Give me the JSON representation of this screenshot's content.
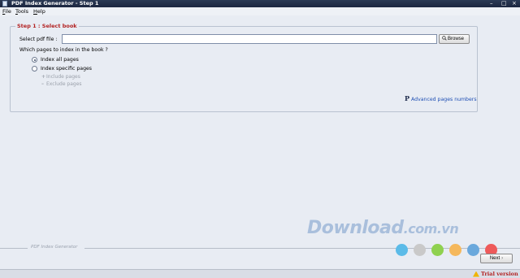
{
  "window": {
    "title": "PDF Index Generator - Step 1"
  },
  "menu": {
    "items": [
      "File",
      "Tools",
      "Help"
    ],
    "underlined": [
      "F",
      "T",
      "H"
    ],
    "rest": [
      "ile",
      "ools",
      "elp"
    ]
  },
  "step": {
    "legend": "Step 1 : Select book",
    "pdf_label": "Select pdf file :",
    "pdf_value": "",
    "browse_label": "Browse",
    "pages_question": "Which pages to index in the book ?",
    "options": [
      {
        "label": "Index all pages",
        "checked": true
      },
      {
        "label": "Index specific pages",
        "checked": false
      }
    ],
    "include_label": "Include pages",
    "exclude_label": "Exclude pages",
    "advanced_label": "Advanced pages numbers"
  },
  "footer": {
    "label": "PDF Index Generator",
    "next_label": "Next"
  },
  "watermark": {
    "main": "Download",
    "tld": ".com.vn",
    "dots": [
      "#5bbbe8",
      "#c9c9c9",
      "#8fd14f",
      "#f5b85c",
      "#6aa8dc",
      "#ee5a5a"
    ]
  },
  "status": {
    "trial": "Trial version"
  },
  "colors": {
    "accent": "#b22222",
    "link": "#1f4fb4",
    "titlebar": "#2b3a55"
  }
}
